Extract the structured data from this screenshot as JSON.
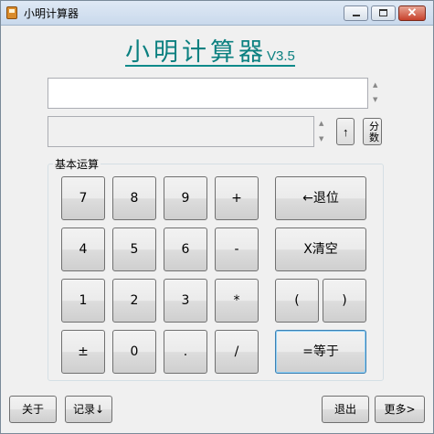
{
  "window": {
    "title": "小明计算器"
  },
  "header": {
    "app_name": "小明计算器",
    "version": "V3.5"
  },
  "display": {
    "input_value": "",
    "result_value": ""
  },
  "side_buttons": {
    "superscript": "↑",
    "fraction": "分数"
  },
  "basic_group": {
    "label": "基本运算",
    "keys": [
      "7",
      "8",
      "9",
      "+",
      "4",
      "5",
      "6",
      "-",
      "1",
      "2",
      "3",
      "*",
      "±",
      "0",
      ".",
      "/"
    ],
    "backspace": "←退位",
    "clear": "X清空",
    "paren_open": "(",
    "paren_close": ")",
    "equals": "=等于"
  },
  "footer": {
    "about": "关于",
    "history": "记录↓",
    "exit": "退出",
    "more": "更多>"
  }
}
